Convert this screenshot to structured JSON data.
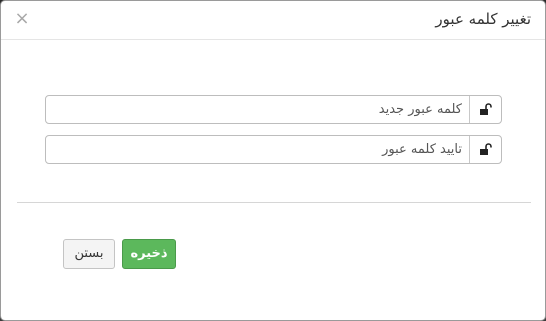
{
  "dialog": {
    "title": "تغییر کلمه عبور",
    "close_glyph": "×"
  },
  "fields": {
    "new_password": {
      "placeholder": "کلمه عبور جدید",
      "value": "",
      "icon": "unlock-icon"
    },
    "confirm_password": {
      "placeholder": "تایید کلمه عبور",
      "value": "",
      "icon": "unlock-icon"
    }
  },
  "buttons": {
    "save_label": "ذخیره",
    "close_label": "بستن"
  },
  "colors": {
    "save_bg": "#5cb85c",
    "close_bg": "#f4f4f4",
    "border": "#bdbdbd",
    "title_text": "#333333"
  }
}
